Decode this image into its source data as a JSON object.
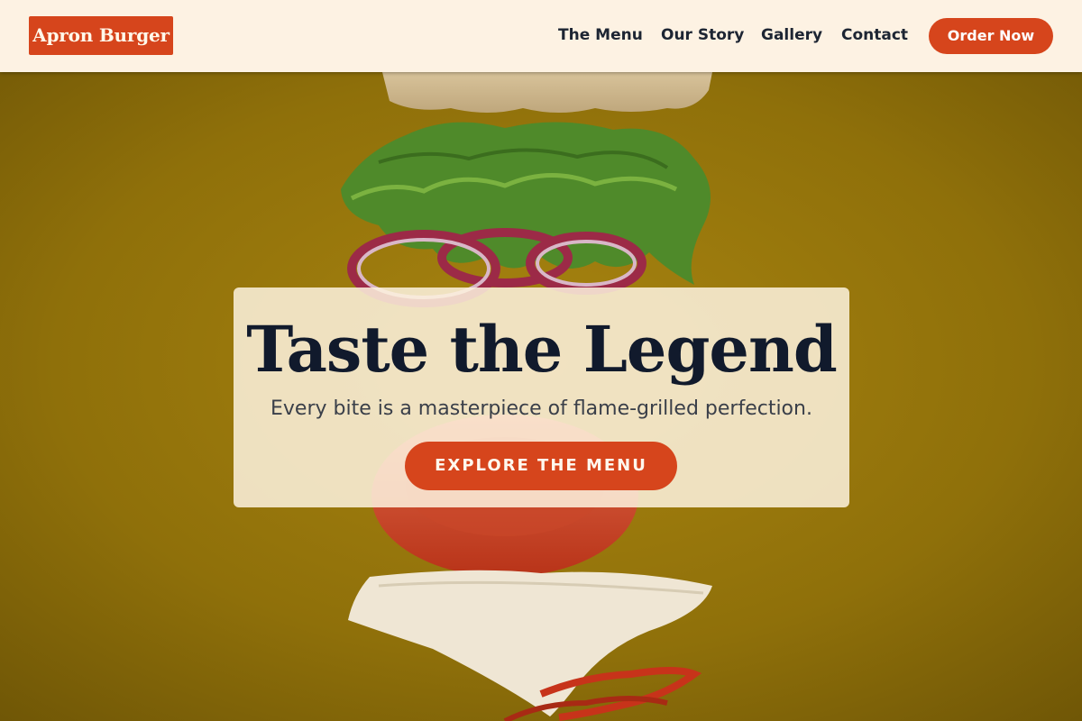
{
  "brand": {
    "logo_text": "Apron Burger",
    "accent_color": "#d6451c"
  },
  "nav": {
    "items": [
      {
        "label": "The Menu"
      },
      {
        "label": "Our Story"
      },
      {
        "label": "Gallery"
      },
      {
        "label": "Contact"
      }
    ],
    "cta_label": "Order Now"
  },
  "hero": {
    "title": "Taste the Legend",
    "subtitle": "Every bite is a masterpiece of flame-grilled perfection.",
    "cta_label": "EXPLORE THE MENU",
    "background": "flying-burger-ingredients"
  }
}
